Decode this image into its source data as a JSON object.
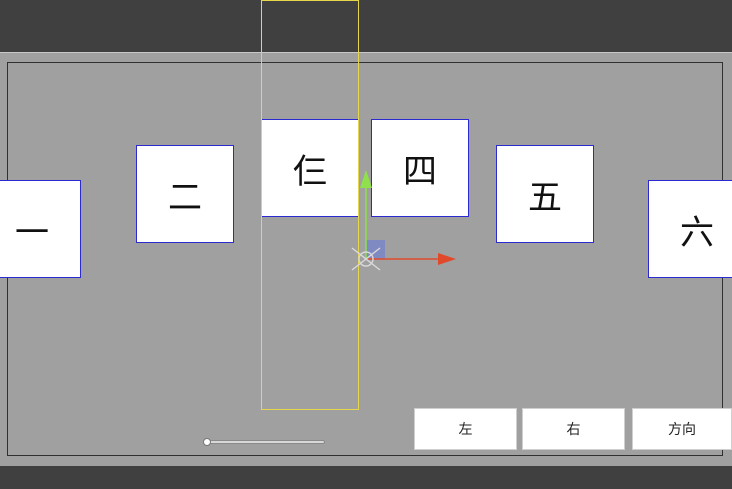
{
  "cards": [
    {
      "id": "card-1",
      "label": "一"
    },
    {
      "id": "card-2",
      "label": "二"
    },
    {
      "id": "card-3",
      "label": "仨"
    },
    {
      "id": "card-4",
      "label": "四"
    },
    {
      "id": "card-5",
      "label": "五"
    },
    {
      "id": "card-6",
      "label": "六"
    }
  ],
  "buttons": {
    "left_label": "左",
    "right_label": "右",
    "direction_label": "方向"
  },
  "slider": {
    "value": 0
  },
  "colors": {
    "card_border": "#2a2ad0",
    "selection": "#e6d64a",
    "gizmo_x": "#e04a2a",
    "gizmo_y": "#8fe04a",
    "gizmo_plane": "#7a86c8"
  },
  "icons": [
    "move-tool-gizmo-icon",
    "pivot-icon"
  ]
}
